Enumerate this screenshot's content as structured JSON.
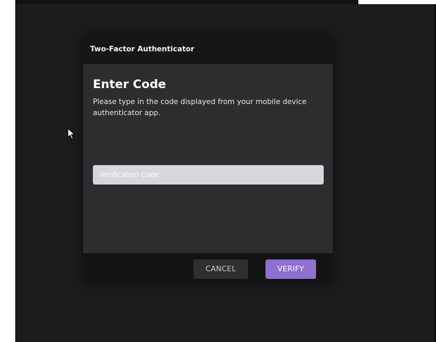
{
  "dialog": {
    "title": "Two-Factor Authenticator",
    "heading": "Enter Code",
    "instructions": "Please type in the code displayed from your mobile device authenticator app.",
    "code_input": {
      "placeholder": "Verification Code",
      "value": ""
    },
    "buttons": {
      "cancel_label": "CANCEL",
      "verify_label": "VERIFY"
    }
  },
  "colors": {
    "background": "#1c1c1e",
    "dialog_body": "#2d2d30",
    "dialog_header": "#161617",
    "accent": "#8f6fd0",
    "input_background": "#d8d5de"
  },
  "icons": {
    "cursor": "mouse-pointer-icon"
  }
}
